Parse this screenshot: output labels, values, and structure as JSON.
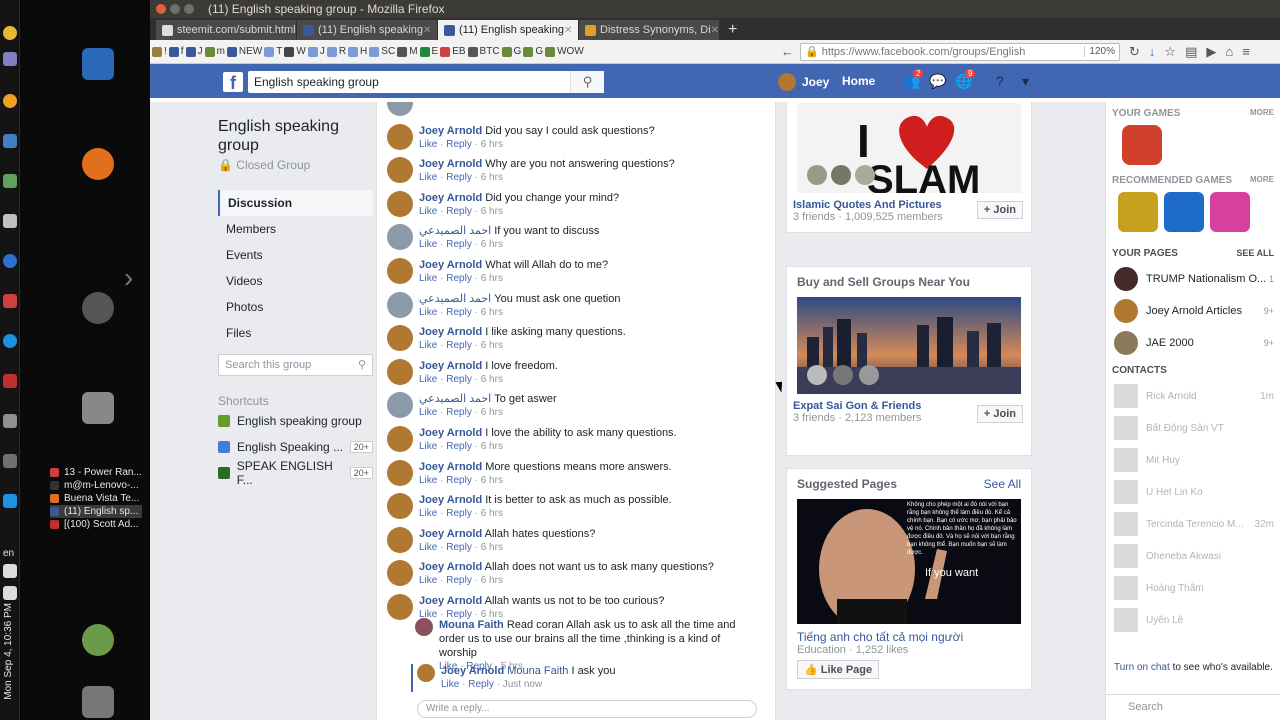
{
  "os": {
    "clock": "Mon Sep 4, 10:36 PM",
    "lang": "en",
    "taskbar": [
      {
        "label": "13 - Power Ran...",
        "active": false
      },
      {
        "label": "m@m-Lenovo-...",
        "active": false
      },
      {
        "label": "Buena Vista Te...",
        "active": false
      },
      {
        "label": "(11) English sp...",
        "active": true
      },
      {
        "label": "[(100) Scott Ad...",
        "active": false
      }
    ]
  },
  "window": {
    "title": "(11) English speaking group - Mozilla Firefox"
  },
  "tabs": [
    {
      "label": "steemit.com/submit.html",
      "selected": false
    },
    {
      "label": "(11) English speaking",
      "selected": false
    },
    {
      "label": "(11) English speaking",
      "selected": true
    },
    {
      "label": "Distress Synonyms, Di",
      "selected": false
    }
  ],
  "newtab": "+",
  "navbar": {
    "url": "https://www.facebook.com/groups/English",
    "zoom": "120%",
    "bookmarks": [
      "!",
      "f",
      "J",
      "m",
      "NEW",
      "T",
      "W",
      "J",
      "R",
      "H",
      "SC",
      "M",
      "E",
      "EB",
      "BTC",
      "G",
      "G",
      "WOW"
    ]
  },
  "fb": {
    "search_value": "English speaking group",
    "user": "Joey",
    "home": "Home",
    "badges": {
      "friends": "2",
      "notifications": "9"
    }
  },
  "group": {
    "title": "English speaking group",
    "type": "Closed Group",
    "nav": [
      "Discussion",
      "Members",
      "Events",
      "Videos",
      "Photos",
      "Files"
    ],
    "search_placeholder": "Search this group",
    "shortcuts_heading": "Shortcuts",
    "shortcuts": [
      {
        "label": "English speaking group",
        "count": ""
      },
      {
        "label": "English Speaking ...",
        "count": "20+"
      },
      {
        "label": "SPEAK ENGLISH F...",
        "count": "20+"
      }
    ]
  },
  "comments": [
    {
      "name": "",
      "text": "",
      "meta": "6 hrs"
    },
    {
      "name": "Joey Arnold",
      "text": "Did you say I could ask questions?",
      "meta": "6 hrs"
    },
    {
      "name": "Joey Arnold",
      "text": "Why are you not answering questions?",
      "meta": "6 hrs"
    },
    {
      "name": "Joey Arnold",
      "text": "Did you change your mind?",
      "meta": "6 hrs"
    },
    {
      "name": "احمد الصميدعي",
      "text": "If you want to discuss",
      "meta": "6 hrs"
    },
    {
      "name": "Joey Arnold",
      "text": "What will Allah do to me?",
      "meta": "6 hrs"
    },
    {
      "name": "احمد الصميدعي",
      "text": "You must ask one quetion",
      "meta": "6 hrs"
    },
    {
      "name": "Joey Arnold",
      "text": "I like asking many questions.",
      "meta": "6 hrs"
    },
    {
      "name": "Joey Arnold",
      "text": "I love freedom.",
      "meta": "6 hrs"
    },
    {
      "name": "احمد الصميدعي",
      "text": "To get aswer",
      "meta": "6 hrs"
    },
    {
      "name": "Joey Arnold",
      "text": "I love the ability to ask many questions.",
      "meta": "6 hrs"
    },
    {
      "name": "Joey Arnold",
      "text": "More questions means more answers.",
      "meta": "6 hrs"
    },
    {
      "name": "Joey Arnold",
      "text": "It is better to ask as much as possible.",
      "meta": "6 hrs"
    },
    {
      "name": "Joey Arnold",
      "text": "Allah hates questions?",
      "meta": "6 hrs"
    },
    {
      "name": "Joey Arnold",
      "text": "Allah does not want us to ask many questions?",
      "meta": "6 hrs"
    },
    {
      "name": "Joey Arnold",
      "text": "Allah wants us not to be too curious?",
      "meta": "6 hrs"
    }
  ],
  "comment_actions": {
    "like": "Like",
    "reply": "Reply"
  },
  "replies": [
    {
      "name": "Mouna Faith",
      "text": "Read coran Allah ask us to ask all the time and order us to use our brains all the time ,thinking is a kind of worship",
      "meta": "5 hrs"
    },
    {
      "name": "Joey Arnold",
      "tag": "Mouna Faith",
      "text": "I ask you",
      "meta": "Just now"
    }
  ],
  "reply_placeholder": "Write a reply...",
  "suggested_groups": [
    {
      "name": "Islamic Quotes And Pictures",
      "meta": "3 friends · 1,009,525 members",
      "join": "Join"
    },
    {
      "name": "Expat Sai Gon & Friends",
      "meta": "3 friends · 2,123 members",
      "join": "Join"
    }
  ],
  "buy_sell_heading": "Buy and Sell Groups Near You",
  "suggested_pages": {
    "heading": "Suggested Pages",
    "see_all": "See All",
    "image_caption": "If you want",
    "image_text": "Không cho phép một ai đó nói với bạn rằng bạn không thể làm điều đó. Kể cả chính bạn. Bạn có ước mơ, bạn phải bảo vệ nó. Chính bản thân họ đã không làm được điều đó. Và họ sẽ nói với bạn rằng bạn không thể. Bạn muốn bạn sẽ làm được.",
    "name": "Tiếng anh cho tất cả mọi người",
    "meta": "Education · 1,252 likes",
    "like_button": "Like Page"
  },
  "right_sidebar": {
    "your_games": "YOUR GAMES",
    "recommended_games": "RECOMMENDED GAMES",
    "more": "MORE",
    "your_pages": "YOUR PAGES",
    "see_all": "SEE ALL",
    "pages": [
      {
        "name": "TRUMP Nationalism O...",
        "count": "1"
      },
      {
        "name": "Joey Arnold Articles",
        "count": "9+"
      },
      {
        "name": "JAE 2000",
        "count": "9+"
      }
    ],
    "contacts_heading": "CONTACTS",
    "contacts": [
      {
        "name": "Rick Arnold",
        "time": "1m"
      },
      {
        "name": "Bất Động Sản VT",
        "time": ""
      },
      {
        "name": "Mit Huy",
        "time": ""
      },
      {
        "name": "U Het Lin Ko",
        "time": ""
      },
      {
        "name": "Tercinda Terencio M...",
        "time": "32m"
      },
      {
        "name": "Oheneba Akwasi",
        "time": ""
      },
      {
        "name": "Hoàng Thâm",
        "time": ""
      },
      {
        "name": "Uyên Lê",
        "time": ""
      }
    ],
    "chat_link": "Turn on chat",
    "chat_note": "to see who's available.",
    "search": "Search"
  }
}
